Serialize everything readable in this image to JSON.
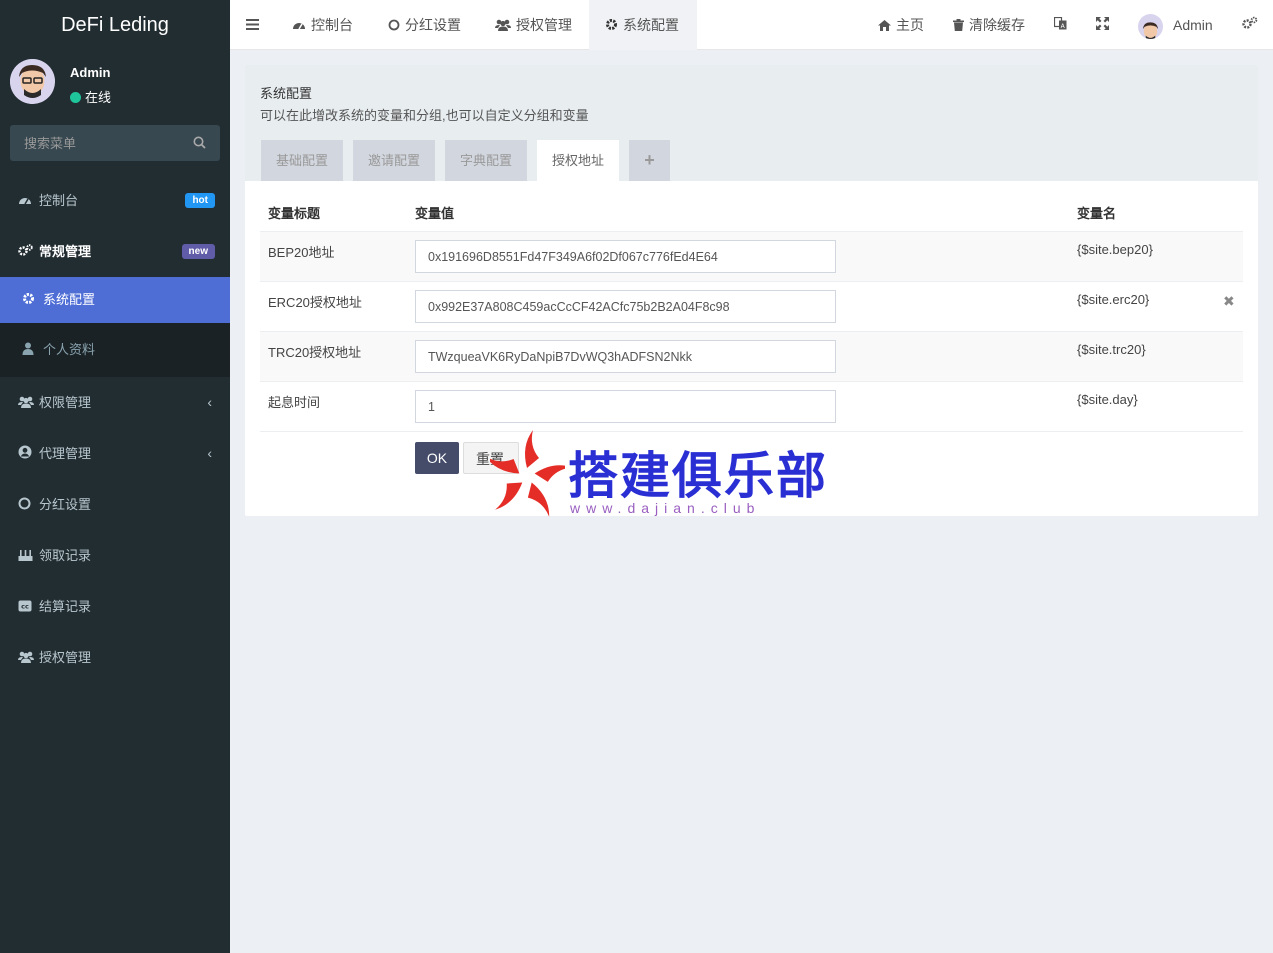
{
  "app": {
    "title": "DeFi Leding"
  },
  "user": {
    "name": "Admin",
    "status": "在线"
  },
  "search": {
    "placeholder": "搜索菜单"
  },
  "sidebar": {
    "items": [
      {
        "label": "控制台",
        "badge": "hot"
      },
      {
        "label": "常规管理",
        "badge": "new"
      },
      {
        "label": "系统配置"
      },
      {
        "label": "个人资料"
      },
      {
        "label": "权限管理"
      },
      {
        "label": "代理管理"
      },
      {
        "label": "分红设置"
      },
      {
        "label": "领取记录"
      },
      {
        "label": "结算记录"
      },
      {
        "label": "授权管理"
      }
    ]
  },
  "header": {
    "tabs": [
      {
        "label": "控制台"
      },
      {
        "label": "分红设置"
      },
      {
        "label": "授权管理"
      },
      {
        "label": "系统配置"
      }
    ],
    "home": "主页",
    "clear_cache": "清除缓存",
    "user": "Admin"
  },
  "panel": {
    "title": "系统配置",
    "description": "可以在此增改系统的变量和分组,也可以自定义分组和变量",
    "tabs": [
      {
        "label": "基础配置"
      },
      {
        "label": "邀请配置"
      },
      {
        "label": "字典配置"
      },
      {
        "label": "授权地址"
      },
      {
        "label": "+"
      }
    ],
    "columns": {
      "title": "变量标题",
      "value": "变量值",
      "name": "变量名"
    },
    "rows": [
      {
        "title": "BEP20地址",
        "value": "0x191696D8551Fd47F349A6f02Df067c776fEd4E64",
        "name": "{$site.bep20}"
      },
      {
        "title": "ERC20授权地址",
        "value": "0x992E37A808C459acCcCF42ACfc75b2B2A04F8c98",
        "name": "{$site.erc20}"
      },
      {
        "title": "TRC20授权地址",
        "value": "TWzqueaVK6RyDaNpiB7DvWQ3hADFSN2Nkk",
        "name": "{$site.trc20}"
      },
      {
        "title": "起息时间",
        "value": "1",
        "name": "{$site.day}"
      }
    ],
    "ok_label": "OK",
    "reset_label": "重置"
  },
  "watermark": {
    "text": "搭建俱乐部",
    "url": "www.dajian.club"
  },
  "colors": {
    "sidebar_bg": "#222d32",
    "active_item": "#4e6ed6",
    "ok_button": "#444c69",
    "online_dot": "#1fc59b"
  }
}
